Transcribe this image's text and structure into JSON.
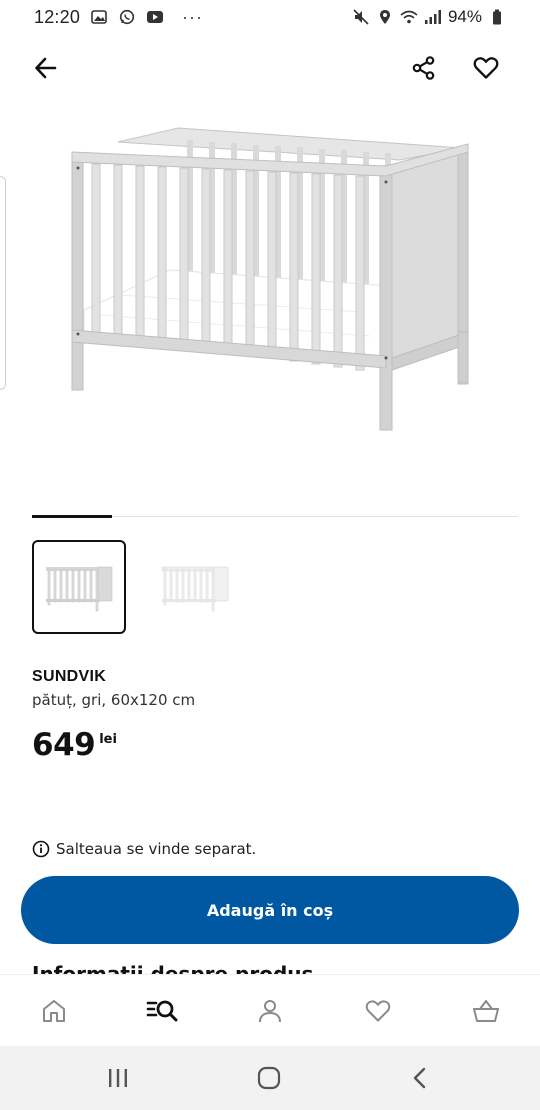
{
  "status_bar": {
    "time": "12:20",
    "more": "···",
    "battery": "94%",
    "icons": [
      "gallery-icon",
      "whatsapp-icon",
      "youtube-icon",
      "mute-icon",
      "location-icon",
      "wifi-icon",
      "signal-icon",
      "battery-icon"
    ]
  },
  "app_bar": {
    "icons": [
      "back-arrow-icon",
      "share-icon",
      "heart-icon"
    ]
  },
  "gallery": {
    "active_index": 0,
    "thumbnail_count": 2
  },
  "product": {
    "name": "SUNDVIK",
    "description": "pătuț, gri, 60x120 cm",
    "price": "649",
    "currency": "lei"
  },
  "notice": {
    "text": "Salteaua se vinde separat.",
    "icon": "info-icon"
  },
  "cta": {
    "label": "Adaugă în coș",
    "color": "#0058a3"
  },
  "next_section": {
    "title": "Informații despre produs"
  },
  "bottom_nav": {
    "items": [
      "home-icon",
      "search-icon",
      "profile-icon",
      "favorites-icon",
      "cart-icon"
    ],
    "active": "search-icon"
  },
  "system_nav": {
    "items": [
      "recents-icon",
      "home-circle-icon",
      "back-chevron-icon"
    ]
  }
}
